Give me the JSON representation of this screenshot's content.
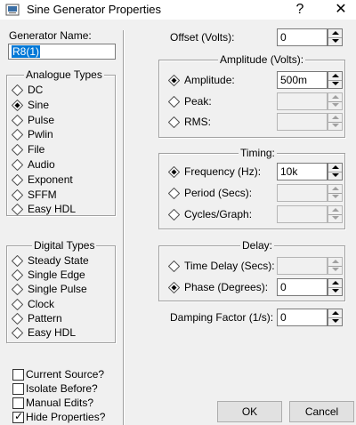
{
  "window": {
    "title": "Sine Generator Properties",
    "help_label": "?",
    "close_label": "✕"
  },
  "generator_name": {
    "label": "Generator Name:",
    "value": "R8(1)"
  },
  "analogue_types": {
    "title": "Analogue Types",
    "selected": "Sine",
    "items": [
      "DC",
      "Sine",
      "Pulse",
      "Pwlin",
      "File",
      "Audio",
      "Exponent",
      "SFFM",
      "Easy HDL"
    ]
  },
  "digital_types": {
    "title": "Digital Types",
    "items": [
      "Steady State",
      "Single Edge",
      "Single Pulse",
      "Clock",
      "Pattern",
      "Easy HDL"
    ]
  },
  "checkboxes": [
    {
      "label": "Current Source?",
      "checked": false
    },
    {
      "label": "Isolate Before?",
      "checked": false
    },
    {
      "label": "Manual Edits?",
      "checked": false
    },
    {
      "label": "Hide Properties?",
      "checked": true
    }
  ],
  "offset": {
    "label": "Offset (Volts):",
    "value": "0"
  },
  "amplitude": {
    "title": "Amplitude (Volts):",
    "rows": [
      {
        "label": "Amplitude:",
        "value": "500m",
        "selected": true
      },
      {
        "label": "Peak:",
        "value": "",
        "selected": false
      },
      {
        "label": "RMS:",
        "value": "",
        "selected": false
      }
    ]
  },
  "timing": {
    "title": "Timing:",
    "rows": [
      {
        "label": "Frequency (Hz):",
        "value": "10k",
        "selected": true
      },
      {
        "label": "Period (Secs):",
        "value": "",
        "selected": false
      },
      {
        "label": "Cycles/Graph:",
        "value": "",
        "selected": false
      }
    ]
  },
  "delay": {
    "title": "Delay:",
    "rows": [
      {
        "label": "Time Delay (Secs):",
        "value": "",
        "selected": false
      },
      {
        "label": "Phase (Degrees):",
        "value": "0",
        "selected": true
      }
    ]
  },
  "damping": {
    "label": "Damping Factor (1/s):",
    "value": "0"
  },
  "buttons": {
    "ok": "OK",
    "cancel": "Cancel"
  },
  "colors": {
    "selection": "#0078d7",
    "background": "#f0f0f0"
  }
}
